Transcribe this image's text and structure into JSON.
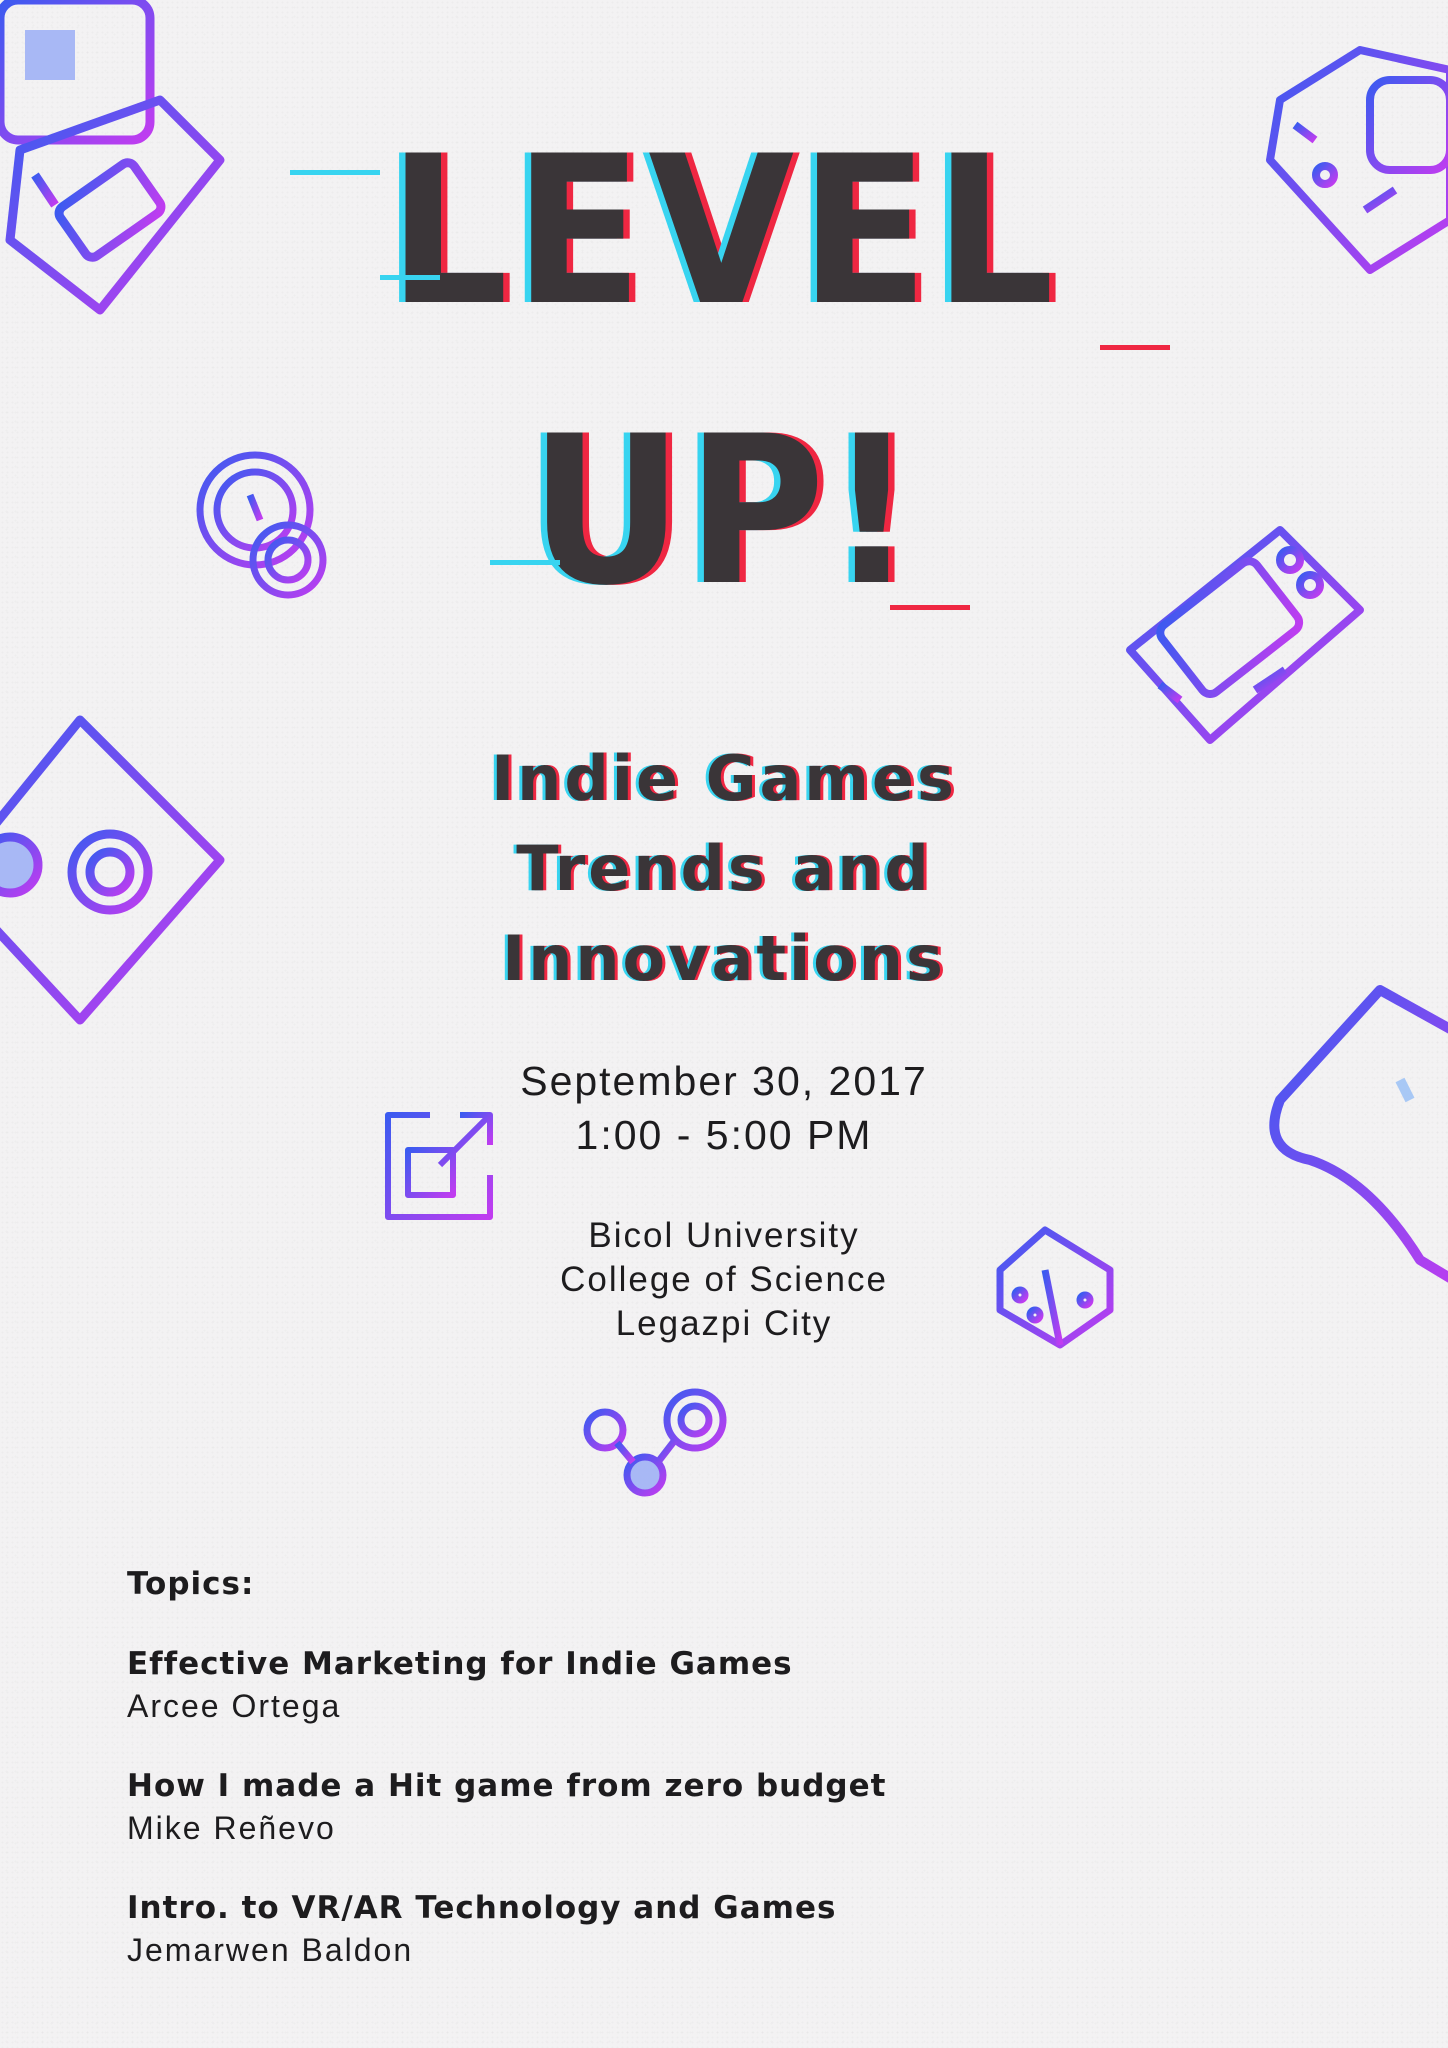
{
  "title": {
    "line1": "LEVEL",
    "line2": "UP!"
  },
  "subtitle": {
    "line1": "Indie Games",
    "line2": "Trends and",
    "line3": "Innovations"
  },
  "event": {
    "date": "September 30, 2017",
    "time": "1:00 - 5:00 PM",
    "venue_line1": "Bicol University",
    "venue_line2": "College of Science",
    "venue_line3": "Legazpi City"
  },
  "topics": {
    "heading": "Topics:",
    "items": [
      {
        "title": "Effective Marketing for Indie Games",
        "speaker": "Arcee Ortega"
      },
      {
        "title": "How I made a Hit game from zero budget",
        "speaker": "Mike Reñevo"
      },
      {
        "title": "Intro. to VR/AR Technology and Games",
        "speaker": "Jemarwen Baldon"
      }
    ]
  },
  "colors": {
    "gradient_start": "#3b5bf0",
    "gradient_end": "#c13cf0",
    "glitch_cyan": "#38d4f0",
    "glitch_red": "#ef2742",
    "text": "#3a3538"
  },
  "icons": [
    "retro-console-icon",
    "handheld-console-icon",
    "coins-icon",
    "gameboy-icon",
    "controller-icon",
    "gamepad-icon",
    "expand-icon",
    "dice-icon",
    "nodes-icon"
  ]
}
